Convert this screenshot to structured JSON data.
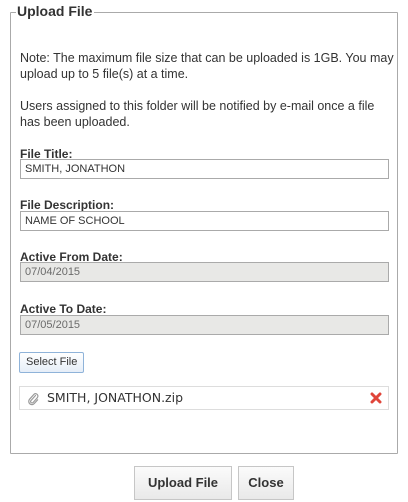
{
  "dialog": {
    "title": "Upload File",
    "note_size": "Note: The maximum file size that can be uploaded is 1GB. You may upload up to 5 file(s) at a time.",
    "note_notify": "Users assigned to this folder will be notified by e-mail once a file has been uploaded."
  },
  "fields": {
    "file_title": {
      "label": "File Title:",
      "value": "SMITH, JONATHON"
    },
    "file_description": {
      "label": "File Description:",
      "value": "NAME OF SCHOOL"
    },
    "active_from": {
      "label": "Active From Date:",
      "value": "07/04/2015"
    },
    "active_to": {
      "label": "Active To Date:",
      "value": "07/05/2015"
    }
  },
  "select_file_label": "Select File",
  "files": [
    {
      "name": "SMITH, JONATHON.zip",
      "icon": "paperclip-icon",
      "remove_icon": "remove-icon"
    }
  ],
  "actions": {
    "upload_label": "Upload File",
    "close_label": "Close"
  },
  "colors": {
    "remove_icon": "#e0453a",
    "select_button_border": "#8fb3d9",
    "disabled_field": "#e8e8e6"
  }
}
